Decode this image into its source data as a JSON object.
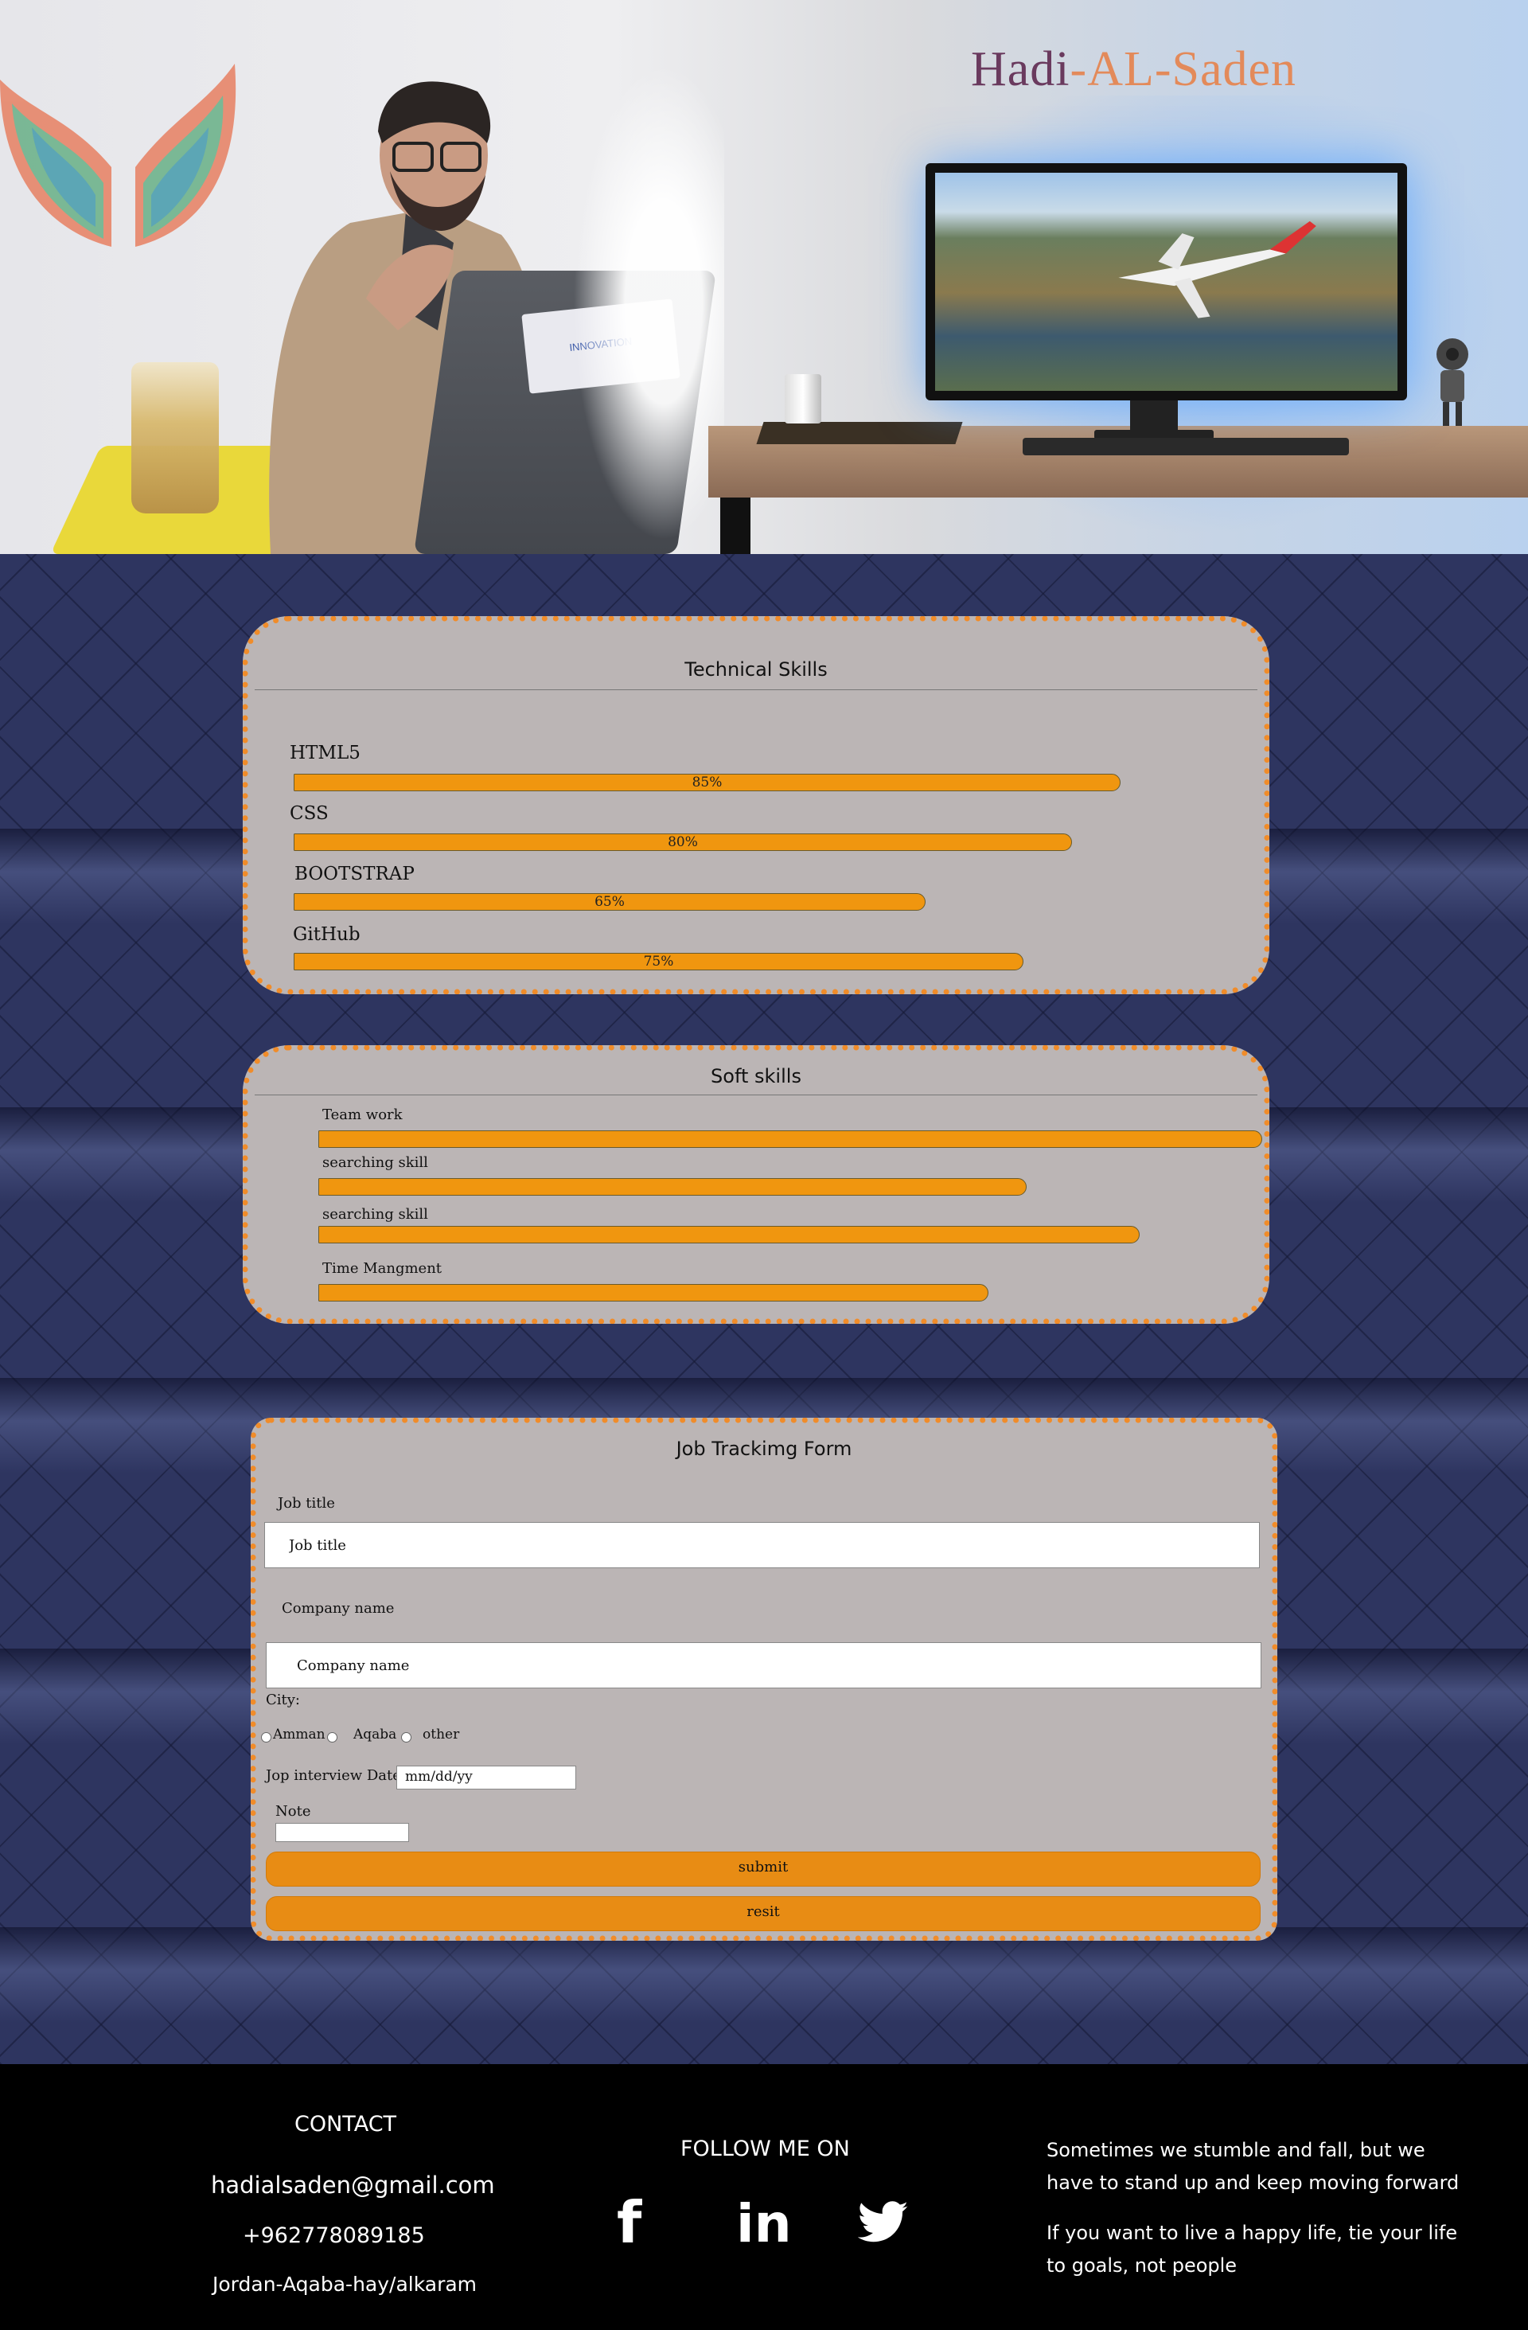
{
  "hero": {
    "name_part1": "Hadi",
    "name_sep1": "-",
    "name_part2": "AL",
    "name_sep2": "-",
    "name_part3": "Saden",
    "laptop_sticker": "INNOVATION"
  },
  "technical_skills": {
    "title": "Technical Skills",
    "items": [
      {
        "label": "HTML5",
        "percent_text": "85%",
        "value": 85
      },
      {
        "label": "CSS",
        "percent_text": "80%",
        "value": 80
      },
      {
        "label": "BOOTSTRAP",
        "percent_text": "65%",
        "value": 65
      },
      {
        "label": "GitHub",
        "percent_text": "75%",
        "value": 75
      }
    ]
  },
  "soft_skills": {
    "title": "Soft skills",
    "items": [
      {
        "label": "Team work",
        "value": 100
      },
      {
        "label": "searching skill",
        "value": 75
      },
      {
        "label": "searching skill",
        "value": 87
      },
      {
        "label": "Time Mangment",
        "value": 71
      }
    ]
  },
  "job_form": {
    "title": "Job Trackimg Form",
    "job_title_label": "Job title",
    "job_title_placeholder": "Job title",
    "company_label": "Company name",
    "company_placeholder": "Company name",
    "city_label": "City:",
    "cities": [
      "Amman",
      "Aqaba",
      "other"
    ],
    "date_label": "Jop interview Date",
    "date_placeholder": "mm/dd/yy",
    "note_label": "Note",
    "submit_label": "submit",
    "reset_label": "resit"
  },
  "footer": {
    "contact_title": "CONTACT",
    "email": "hadialsaden@gmail.com",
    "phone": "+962778089185",
    "address": "Jordan-Aqaba-hay/alkaram",
    "follow_title": "FOLLOW ME ON",
    "social": [
      {
        "icon": "facebook-icon",
        "glyph": "f"
      },
      {
        "icon": "linkedin-icon",
        "glyph": "in"
      },
      {
        "icon": "twitter-icon",
        "glyph": "bird"
      }
    ],
    "quote1": "Sometimes we stumble and fall, but we have to stand up and keep moving forward",
    "quote2": "If you want to live a happy life, tie your life to goals, not people"
  },
  "colors": {
    "accent": "#f0960f",
    "card_bg": "#bbb5b5",
    "page_bg": "#2e3560",
    "footer_bg": "#000000"
  }
}
